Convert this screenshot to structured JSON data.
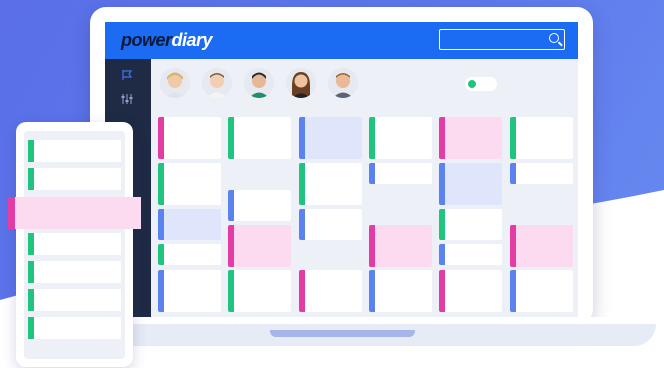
{
  "app": {
    "logo_part1": "power",
    "logo_part2": "diary"
  },
  "colors": {
    "brand_blue": "#1b6cf3",
    "sidebar_dark": "#1f2a44",
    "green": "#1fc47f",
    "blue": "#5a83ef",
    "magenta": "#e43ca5",
    "pink_fill": "#fcdaf0",
    "light_blue_fill": "#dfe5fa"
  },
  "header": {
    "search_icon": "search-icon"
  },
  "sidebar": {
    "items": [
      {
        "icon": "flag-icon"
      },
      {
        "icon": "sliders-icon"
      }
    ]
  },
  "practitioners": [
    {
      "name": "avatar-1"
    },
    {
      "name": "avatar-2"
    },
    {
      "name": "avatar-3"
    },
    {
      "name": "avatar-4"
    },
    {
      "name": "avatar-5"
    }
  ]
}
